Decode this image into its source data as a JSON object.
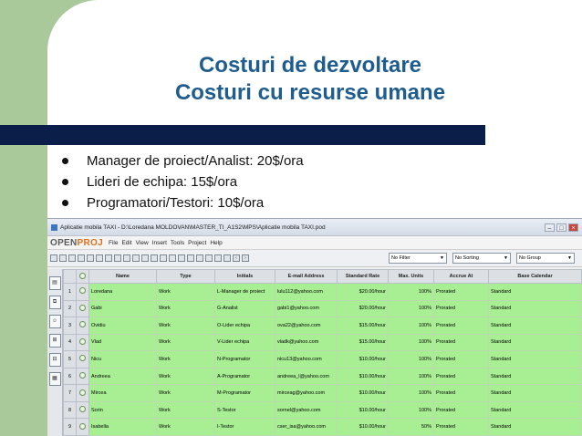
{
  "slide": {
    "title_line1": "Costuri de dezvoltare",
    "title_line2": "Costuri cu resurse umane",
    "bullets": [
      "Manager de proiect/Analist: 20$/ora",
      "Lideri de echipa: 15$/ora",
      "Programatori/Testori: 10$/ora"
    ],
    "colors": {
      "accent_green": "#a9c99a",
      "navy_bar": "#0b1e4a",
      "title_blue": "#1f5c8f"
    }
  },
  "app": {
    "window_title": "Aplicatie mobila TAXI - D:\\Loredana MOLDOVAN\\MASTER_TI_A1S2\\MPS\\Aplicatie mobila TAXI.pod",
    "logo_open": "OPEN",
    "logo_proj": "PROJ",
    "menu": [
      "File",
      "Edit",
      "View",
      "Insert",
      "Tools",
      "Project",
      "Help"
    ],
    "filters": {
      "filter": "No Filter",
      "sorting": "No Sorting",
      "group": "No Group"
    },
    "columns": [
      "",
      "",
      "Name",
      "Type",
      "Initials",
      "E-mail Address",
      "Standard Rate",
      "Max. Units",
      "Accrue At",
      "Base Calendar"
    ],
    "rows": [
      {
        "n": "1",
        "name": "Loredana",
        "type": "Work",
        "initials": "L-Manager de proiect",
        "email": "lulu112@yahoo.com",
        "rate": "$20.00/hour",
        "max": "100%",
        "accrue": "Prorated",
        "cal": "Standard"
      },
      {
        "n": "2",
        "name": "Gabi",
        "type": "Work",
        "initials": "G-Analist",
        "email": "gabi1@yahoo.com",
        "rate": "$20.00/hour",
        "max": "100%",
        "accrue": "Prorated",
        "cal": "Standard"
      },
      {
        "n": "3",
        "name": "Ovidiu",
        "type": "Work",
        "initials": "O-Lider echipa",
        "email": "ova22@yahoo.com",
        "rate": "$15.00/hour",
        "max": "100%",
        "accrue": "Prorated",
        "cal": "Standard"
      },
      {
        "n": "4",
        "name": "Vlad",
        "type": "Work",
        "initials": "V-Lider echipa",
        "email": "vladk@yahoo.com",
        "rate": "$15.00/hour",
        "max": "100%",
        "accrue": "Prorated",
        "cal": "Standard"
      },
      {
        "n": "5",
        "name": "Nicu",
        "type": "Work",
        "initials": "N-Programator",
        "email": "nicu13@yahoo.com",
        "rate": "$10.00/hour",
        "max": "100%",
        "accrue": "Prorated",
        "cal": "Standard"
      },
      {
        "n": "6",
        "name": "Andreea",
        "type": "Work",
        "initials": "A-Programator",
        "email": "andreea_l@yahoo.com",
        "rate": "$10.00/hour",
        "max": "100%",
        "accrue": "Prorated",
        "cal": "Standard"
      },
      {
        "n": "7",
        "name": "Mircea",
        "type": "Work",
        "initials": "M-Programator",
        "email": "mirceag@yahoo.com",
        "rate": "$10.00/hour",
        "max": "100%",
        "accrue": "Prorated",
        "cal": "Standard"
      },
      {
        "n": "8",
        "name": "Sorin",
        "type": "Work",
        "initials": "S-Testor",
        "email": "sornel@yahoo.com",
        "rate": "$10.00/hour",
        "max": "100%",
        "accrue": "Prorated",
        "cal": "Standard"
      },
      {
        "n": "9",
        "name": "Isabella",
        "type": "Work",
        "initials": "I-Testor",
        "email": "cser_isa@yahoo.com",
        "rate": "$10.00/hour",
        "max": "50%",
        "accrue": "Prorated",
        "cal": "Standard"
      }
    ]
  }
}
